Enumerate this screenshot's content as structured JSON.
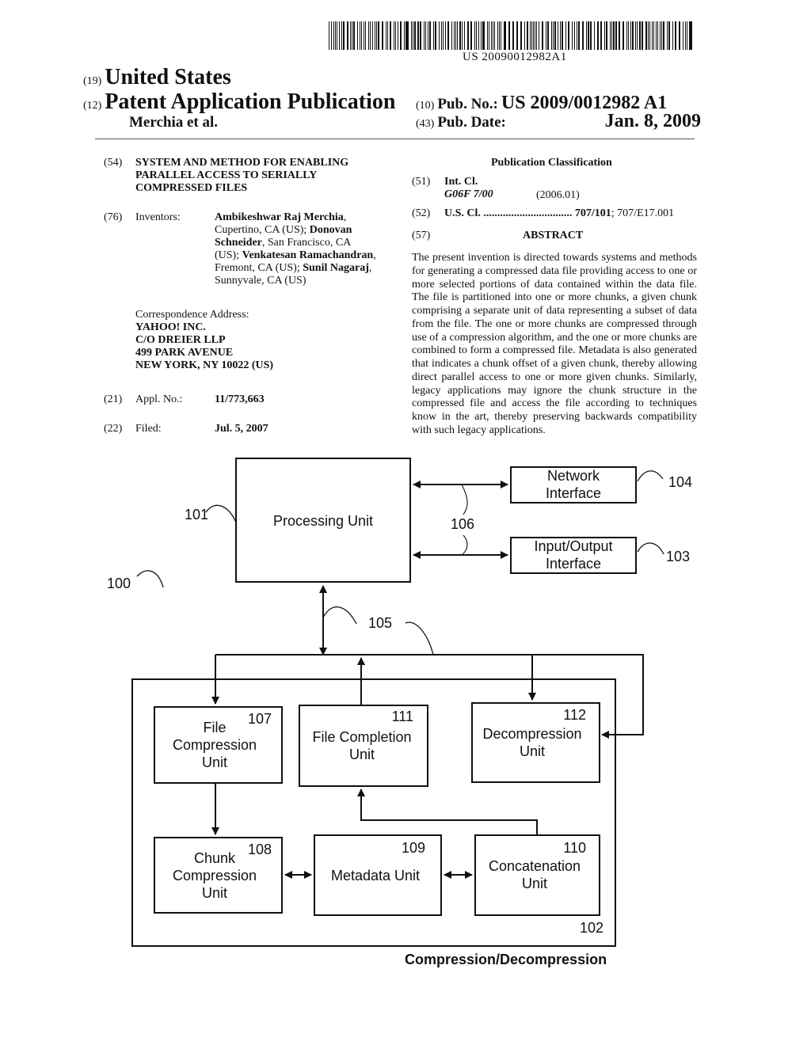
{
  "header": {
    "barcode_text": "US 20090012982A1",
    "country_code": "(19)",
    "country": "United States",
    "type_code": "(12)",
    "type": "Patent Application Publication",
    "authors": "Merchia et al.",
    "pub_no_code": "(10)",
    "pub_no_label": "Pub. No.:",
    "pub_no": "US 2009/0012982 A1",
    "pub_date_code": "(43)",
    "pub_date_label": "Pub. Date:",
    "pub_date": "Jan. 8, 2009"
  },
  "left": {
    "title_code": "(54)",
    "title_lines": [
      "SYSTEM AND METHOD FOR ENABLING",
      "PARALLEL ACCESS TO SERIALLY",
      "COMPRESSED FILES"
    ],
    "inventors_code": "(76)",
    "inventors_label": "Inventors:",
    "inventors_lines": [
      [
        {
          "t": "Ambikeshwar Raj Merchia",
          "b": true
        },
        {
          "t": ",",
          "b": false
        }
      ],
      [
        {
          "t": "Cupertino, CA (US); ",
          "b": false
        },
        {
          "t": "Donovan",
          "b": true
        }
      ],
      [
        {
          "t": "Schneider",
          "b": true
        },
        {
          "t": ", San Francisco, CA",
          "b": false
        }
      ],
      [
        {
          "t": "(US); ",
          "b": false
        },
        {
          "t": "Venkatesan Ramachandran",
          "b": true
        },
        {
          "t": ",",
          "b": false
        }
      ],
      [
        {
          "t": "Fremont, CA (US); ",
          "b": false
        },
        {
          "t": "Sunil Nagaraj",
          "b": true
        },
        {
          "t": ",",
          "b": false
        }
      ],
      [
        {
          "t": "Sunnyvale, CA (US)",
          "b": false
        }
      ]
    ],
    "correspondence_label": "Correspondence Address:",
    "correspondence_lines": [
      "YAHOO! INC.",
      "C/O DREIER LLP",
      "499 PARK AVENUE",
      "NEW YORK, NY 10022 (US)"
    ],
    "appl_code": "(21)",
    "appl_label": "Appl. No.:",
    "appl_no": "11/773,663",
    "filed_code": "(22)",
    "filed_label": "Filed:",
    "filed": "Jul. 5, 2007"
  },
  "right": {
    "classification_heading": "Publication Classification",
    "int_cl_code": "(51)",
    "int_cl_label": "Int. Cl.",
    "int_cl_value": "G06F 7/00",
    "int_cl_version": "(2006.01)",
    "us_cl_code": "(52)",
    "us_cl_label": "U.S. Cl. ................................",
    "us_cl_primary": "707/101",
    "us_cl_secondary": "; 707/E17.001",
    "abstract_code": "(57)",
    "abstract_heading": "ABSTRACT",
    "abstract_text": "The present invention is directed towards systems and methods for generating a compressed data file providing access to one or more selected portions of data contained within the data file. The file is partitioned into one or more chunks, a given chunk comprising a separate unit of data representing a subset of data from the file. The one or more chunks are compressed through use of a compression algorithm, and the one or more chunks are combined to form a compressed file. Metadata is also generated that indicates a chunk offset of a given chunk, thereby allowing direct parallel access to one or more given chunks. Similarly, legacy applications may ignore the chunk structure in the compressed file and access the file according to techniques know in the art, thereby preserving backwards compatibility with such legacy applications."
  },
  "diagram": {
    "system_ref": "100",
    "processing_unit": {
      "label": "Processing Unit",
      "ref": "101"
    },
    "network_interface": {
      "lines": [
        "Network",
        "Interface"
      ],
      "ref": "104"
    },
    "io_interface": {
      "lines": [
        "Input/Output",
        "Interface"
      ],
      "ref": "103"
    },
    "link_ref": "106",
    "bus_ref": "105",
    "module_ref": "102",
    "module_caption": "Compression/Decompression",
    "file_compression": {
      "lines": [
        "File",
        "Compression",
        "Unit"
      ],
      "ref": "107"
    },
    "file_completion": {
      "lines": [
        "File Completion",
        "Unit"
      ],
      "ref": "111"
    },
    "decompression": {
      "lines": [
        "Decompression",
        "Unit"
      ],
      "ref": "112"
    },
    "chunk_compression": {
      "lines": [
        "Chunk",
        "Compression",
        "Unit"
      ],
      "ref": "108"
    },
    "metadata": {
      "lines": [
        "Metadata Unit"
      ],
      "ref": "109"
    },
    "concatenation": {
      "lines": [
        "Concatenation",
        "Unit"
      ],
      "ref": "110"
    }
  }
}
